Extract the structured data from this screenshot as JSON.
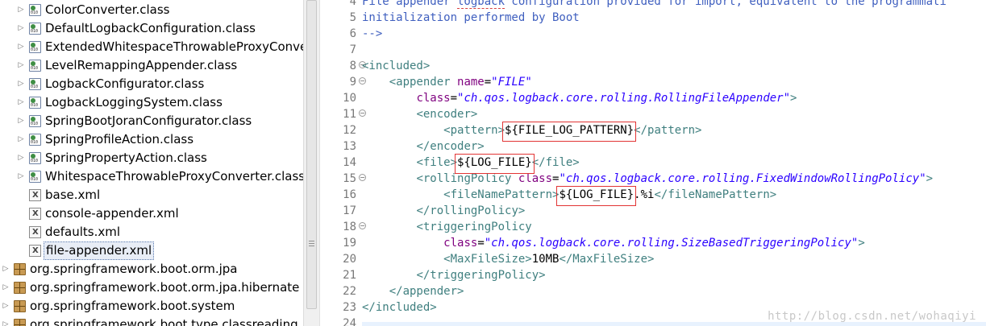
{
  "tree": {
    "items": [
      {
        "label": "ColorConverter.class",
        "kind": "class",
        "icon": "class-file-icon"
      },
      {
        "label": "DefaultLogbackConfiguration.class",
        "kind": "class",
        "icon": "class-file-icon"
      },
      {
        "label": "ExtendedWhitespaceThrowableProxyConve",
        "kind": "class",
        "icon": "class-file-icon"
      },
      {
        "label": "LevelRemappingAppender.class",
        "kind": "class",
        "icon": "class-file-icon"
      },
      {
        "label": "LogbackConfigurator.class",
        "kind": "class",
        "icon": "class-file-icon"
      },
      {
        "label": "LogbackLoggingSystem.class",
        "kind": "class",
        "icon": "class-file-icon"
      },
      {
        "label": "SpringBootJoranConfigurator.class",
        "kind": "class",
        "icon": "class-file-icon"
      },
      {
        "label": "SpringProfileAction.class",
        "kind": "class",
        "icon": "class-file-icon"
      },
      {
        "label": "SpringPropertyAction.class",
        "kind": "class",
        "icon": "class-file-icon"
      },
      {
        "label": "WhitespaceThrowableProxyConverter.class",
        "kind": "class",
        "icon": "class-file-icon"
      },
      {
        "label": "base.xml",
        "kind": "xml",
        "icon": "xml-file-icon"
      },
      {
        "label": "console-appender.xml",
        "kind": "xml",
        "icon": "xml-file-icon"
      },
      {
        "label": "defaults.xml",
        "kind": "xml",
        "icon": "xml-file-icon"
      },
      {
        "label": "file-appender.xml",
        "kind": "xml",
        "icon": "xml-file-icon",
        "selected": true
      },
      {
        "label": "org.springframework.boot.orm.jpa",
        "kind": "package",
        "icon": "package-icon"
      },
      {
        "label": "org.springframework.boot.orm.jpa.hibernate",
        "kind": "package",
        "icon": "package-icon"
      },
      {
        "label": "org.springframework.boot.system",
        "kind": "package",
        "icon": "package-icon"
      },
      {
        "label": "org.springframework.boot.type.classreading",
        "kind": "package",
        "icon": "package-icon"
      }
    ]
  },
  "editor": {
    "lines": [
      {
        "n": "4",
        "tokens": [
          {
            "c": "cmt",
            "t": "File appender logback configuration provided for import, equivalent to the programmati"
          }
        ]
      },
      {
        "n": "5",
        "tokens": [
          {
            "c": "cmt",
            "t": "initialization performed by Boot"
          }
        ]
      },
      {
        "n": "6",
        "tokens": [
          {
            "c": "cmt",
            "t": "-->"
          }
        ]
      },
      {
        "n": "7",
        "tokens": []
      },
      {
        "n": "8",
        "fold": true,
        "tokens": [
          {
            "c": "tag",
            "t": "<included>"
          }
        ]
      },
      {
        "n": "9",
        "fold": true,
        "tokens": [
          {
            "c": "txt",
            "t": "    "
          },
          {
            "c": "tag",
            "t": "<appender "
          },
          {
            "c": "attr",
            "t": "name"
          },
          {
            "c": "txt",
            "t": "="
          },
          {
            "c": "val",
            "t": "\"FILE\""
          }
        ]
      },
      {
        "n": "10",
        "tokens": [
          {
            "c": "txt",
            "t": "        "
          },
          {
            "c": "attr",
            "t": "class"
          },
          {
            "c": "txt",
            "t": "="
          },
          {
            "c": "val",
            "t": "\"ch.qos.logback.core.rolling.RollingFileAppender\""
          },
          {
            "c": "tag",
            "t": ">"
          }
        ]
      },
      {
        "n": "11",
        "fold": true,
        "tokens": [
          {
            "c": "txt",
            "t": "        "
          },
          {
            "c": "tag",
            "t": "<encoder>"
          }
        ]
      },
      {
        "n": "12",
        "tokens": [
          {
            "c": "txt",
            "t": "            "
          },
          {
            "c": "tag",
            "t": "<pattern>"
          },
          {
            "c": "txt",
            "t": "${FILE_LOG_PATTERN}"
          },
          {
            "c": "tag",
            "t": "</pattern>"
          }
        ]
      },
      {
        "n": "13",
        "tokens": [
          {
            "c": "txt",
            "t": "        "
          },
          {
            "c": "tag",
            "t": "</encoder>"
          }
        ]
      },
      {
        "n": "14",
        "tokens": [
          {
            "c": "txt",
            "t": "        "
          },
          {
            "c": "tag",
            "t": "<file>"
          },
          {
            "c": "txt",
            "t": "${LOG_FILE}"
          },
          {
            "c": "tag",
            "t": "</file>"
          }
        ]
      },
      {
        "n": "15",
        "fold": true,
        "tokens": [
          {
            "c": "txt",
            "t": "        "
          },
          {
            "c": "tag",
            "t": "<rollingPolicy "
          },
          {
            "c": "attr",
            "t": "class"
          },
          {
            "c": "txt",
            "t": "="
          },
          {
            "c": "val",
            "t": "\"ch.qos.logback.core.rolling.FixedWindowRollingPolicy\""
          },
          {
            "c": "tag",
            "t": ">"
          }
        ]
      },
      {
        "n": "16",
        "tokens": [
          {
            "c": "txt",
            "t": "            "
          },
          {
            "c": "tag",
            "t": "<fileNamePattern>"
          },
          {
            "c": "txt",
            "t": "${LOG_FILE}.%i"
          },
          {
            "c": "tag",
            "t": "</fileNamePattern>"
          }
        ]
      },
      {
        "n": "17",
        "tokens": [
          {
            "c": "txt",
            "t": "        "
          },
          {
            "c": "tag",
            "t": "</rollingPolicy>"
          }
        ]
      },
      {
        "n": "18",
        "fold": true,
        "tokens": [
          {
            "c": "txt",
            "t": "        "
          },
          {
            "c": "tag",
            "t": "<triggeringPolicy"
          }
        ]
      },
      {
        "n": "19",
        "tokens": [
          {
            "c": "txt",
            "t": "            "
          },
          {
            "c": "attr",
            "t": "class"
          },
          {
            "c": "txt",
            "t": "="
          },
          {
            "c": "val",
            "t": "\"ch.qos.logback.core.rolling.SizeBasedTriggeringPolicy\""
          },
          {
            "c": "tag",
            "t": ">"
          }
        ]
      },
      {
        "n": "20",
        "tokens": [
          {
            "c": "txt",
            "t": "            "
          },
          {
            "c": "tag",
            "t": "<MaxFileSize>"
          },
          {
            "c": "txt",
            "t": "10MB"
          },
          {
            "c": "tag",
            "t": "</MaxFileSize>"
          }
        ]
      },
      {
        "n": "21",
        "tokens": [
          {
            "c": "txt",
            "t": "        "
          },
          {
            "c": "tag",
            "t": "</triggeringPolicy>"
          }
        ]
      },
      {
        "n": "22",
        "tokens": [
          {
            "c": "txt",
            "t": "    "
          },
          {
            "c": "tag",
            "t": "</appender>"
          }
        ]
      },
      {
        "n": "23",
        "tokens": [
          {
            "c": "tag",
            "t": "</included>"
          }
        ]
      },
      {
        "n": "24",
        "tokens": []
      }
    ],
    "highlighted": [
      "${FILE_LOG_PATTERN}",
      "${LOG_FILE}",
      "${LOG_FILE}"
    ],
    "watermark": "http://blog.csdn.net/wohaqiyi"
  },
  "colors": {
    "tag": "#3f7f7f",
    "attr": "#7f007f",
    "val": "#2a00ff",
    "cmt": "#3f5fbf",
    "highlight_box": "#e23434"
  }
}
